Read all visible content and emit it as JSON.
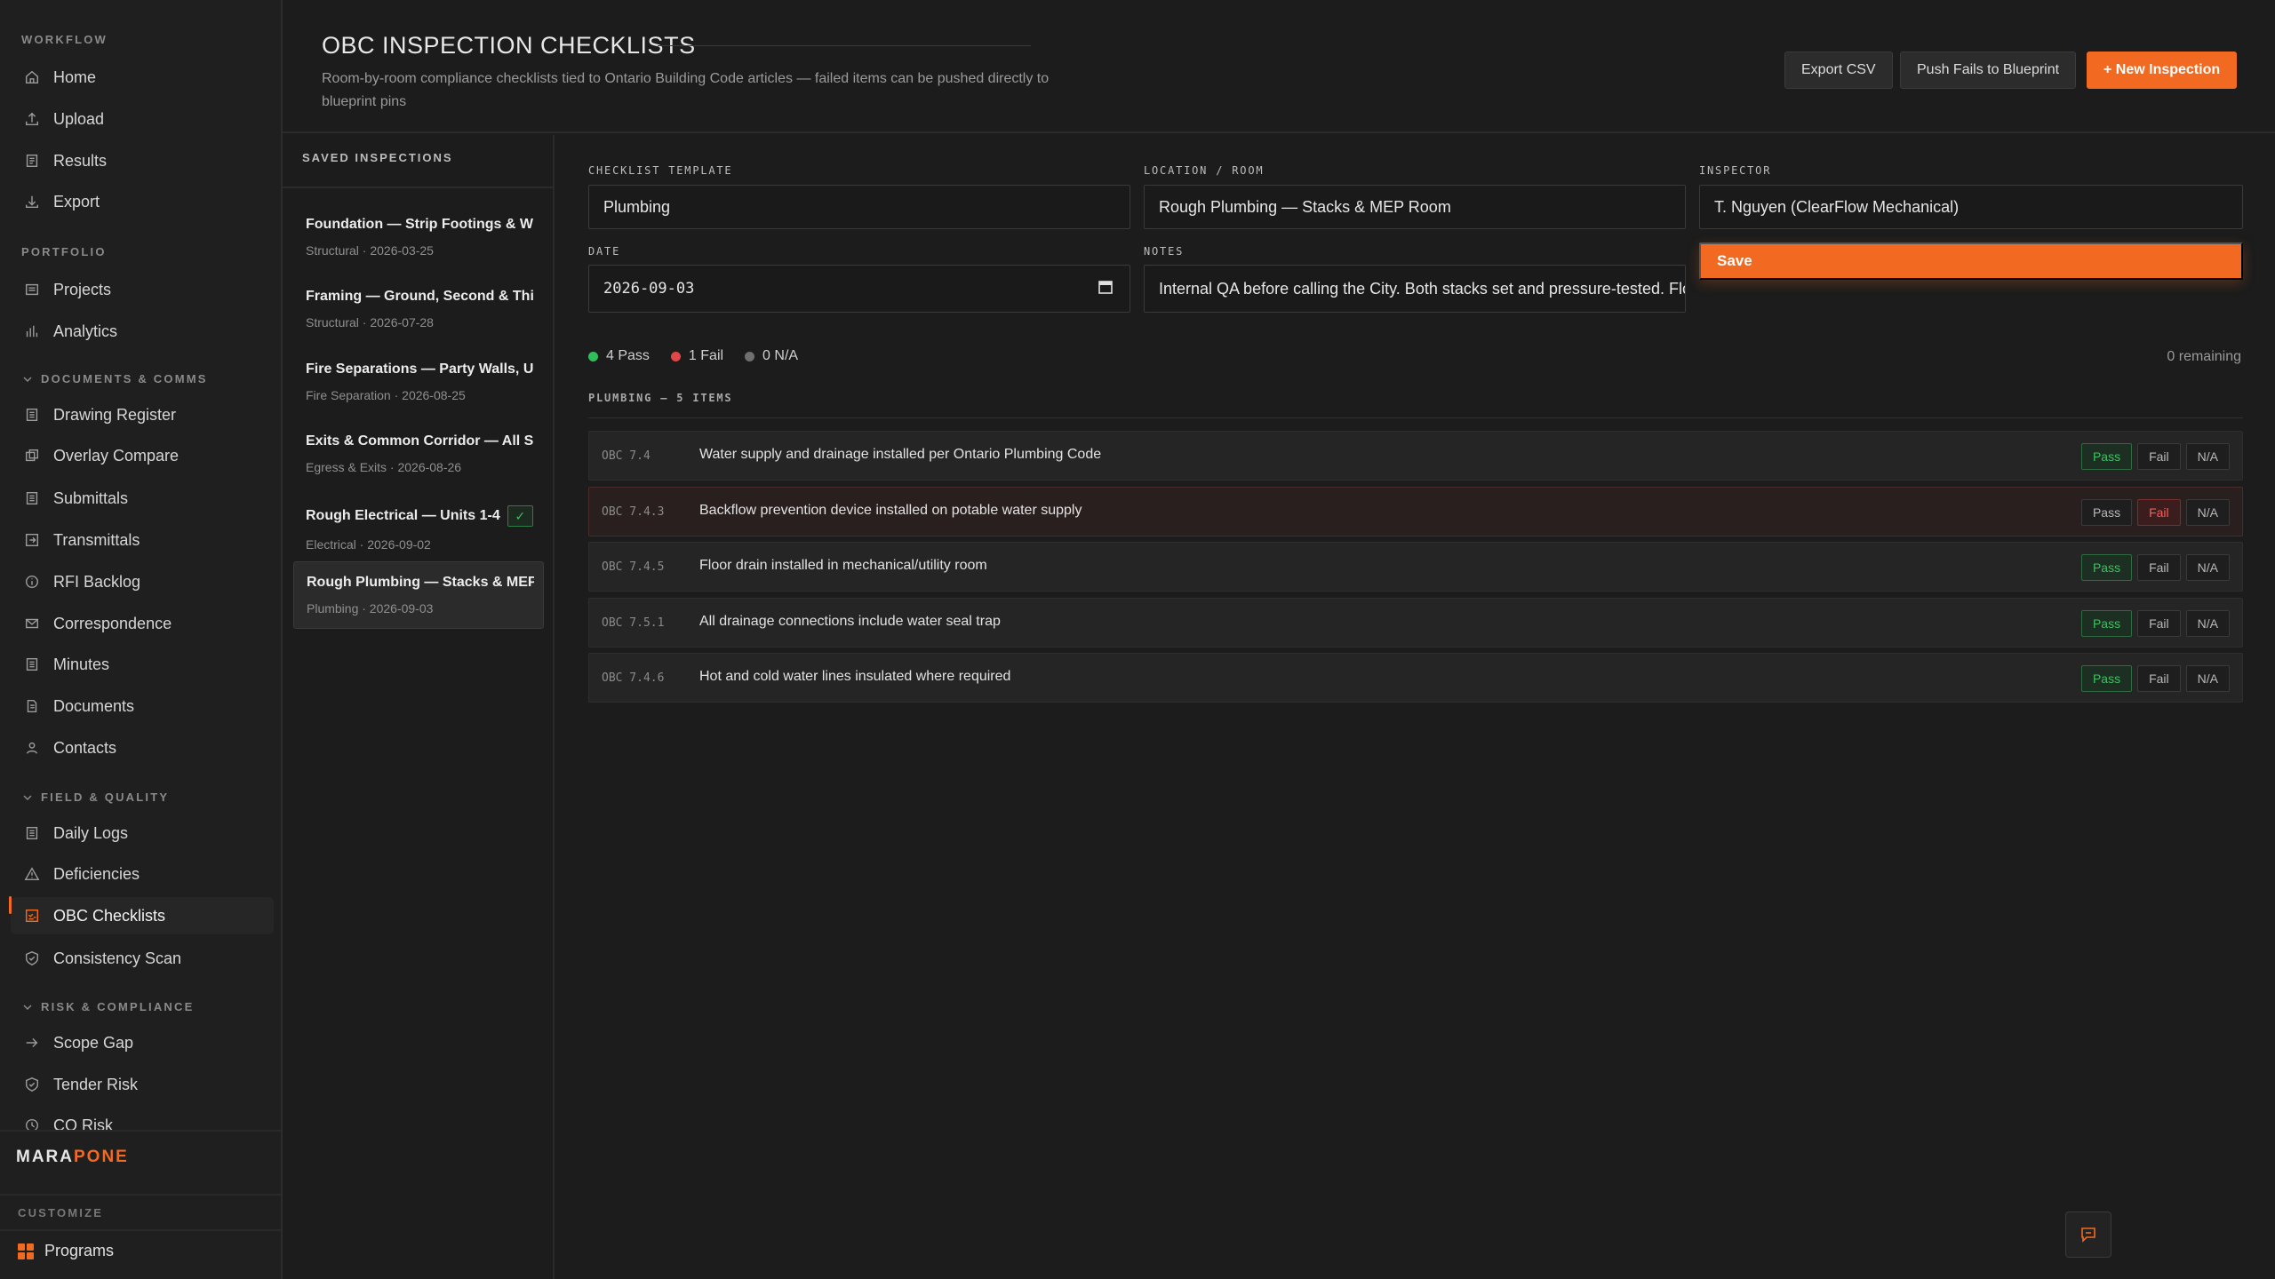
{
  "sidebar": {
    "sections": {
      "workflow": "WORKFLOW",
      "portfolio": "PORTFOLIO",
      "documents": "DOCUMENTS & COMMS",
      "field": "FIELD & QUALITY",
      "risk": "RISK & COMPLIANCE"
    },
    "workflow_items": [
      "Home",
      "Upload",
      "Results",
      "Export"
    ],
    "portfolio_items": [
      "Projects",
      "Analytics"
    ],
    "documents_items": [
      "Drawing Register",
      "Overlay Compare",
      "Submittals",
      "Transmittals",
      "RFI Backlog",
      "Correspondence",
      "Minutes",
      "Documents",
      "Contacts"
    ],
    "field_items": [
      "Daily Logs",
      "Deficiencies",
      "OBC Checklists",
      "Consistency Scan"
    ],
    "risk_items": [
      "Scope Gap",
      "Tender Risk",
      "CO Risk"
    ],
    "active_item": "OBC Checklists",
    "brand_main": "MARA",
    "brand_accent": "PONE",
    "customize_label": "CUSTOMIZE",
    "programs_label": "Programs"
  },
  "header": {
    "title": "OBC INSPECTION CHECKLISTS",
    "subtitle": "Room-by-room compliance checklists tied to Ontario Building Code articles — failed items can be pushed directly to blueprint pins",
    "export_csv": "Export CSV",
    "push_fails": "Push Fails to Blueprint",
    "new_inspection": "+ New Inspection"
  },
  "saved": {
    "heading": "SAVED INSPECTIONS",
    "items": [
      {
        "title": "Foundation — Strip Footings & W...",
        "meta": "Structural · 2026-03-25"
      },
      {
        "title": "Framing — Ground, Second & Thi...",
        "meta": "Structural · 2026-07-28"
      },
      {
        "title": "Fire Separations — Party Walls, U...",
        "meta": "Fire Separation · 2026-08-25"
      },
      {
        "title": "Exits & Common Corridor — All S...",
        "meta": "Egress & Exits · 2026-08-26"
      },
      {
        "title": "Rough Electrical — Units 1-4",
        "meta": "Electrical · 2026-09-02",
        "badge": "✓"
      },
      {
        "title": "Rough Plumbing — Stacks & MEP...",
        "meta": "Plumbing · 2026-09-03"
      }
    ]
  },
  "form": {
    "template_label": "CHECKLIST TEMPLATE",
    "template_value": "Plumbing",
    "location_label": "LOCATION / ROOM",
    "location_value": "Rough Plumbing — Stacks & MEP Room",
    "inspector_label": "INSPECTOR",
    "inspector_value": "T. Nguyen (ClearFlow Mechanical)",
    "date_label": "DATE",
    "date_value": "2026-09-03",
    "notes_label": "NOTES",
    "notes_value": "Internal QA before calling the City. Both stacks set and pressure-tested. Floor drain",
    "save_label": "Save"
  },
  "summary": {
    "pass": "4 Pass",
    "fail": "1 Fail",
    "na": "0 N/A",
    "remaining": "0 remaining",
    "colors": {
      "pass": "#2fbf5a",
      "fail": "#e04848",
      "na": "#6f6f6f"
    }
  },
  "checklist": {
    "group": "PLUMBING — 5 ITEMS",
    "option_labels": {
      "pass": "Pass",
      "fail": "Fail",
      "na": "N/A"
    },
    "items": [
      {
        "code": "OBC 7.4",
        "text": "Water supply and drainage installed per Ontario Plumbing Code",
        "status": "pass"
      },
      {
        "code": "OBC 7.4.3",
        "text": "Backflow prevention device installed on potable water supply",
        "status": "fail"
      },
      {
        "code": "OBC 7.4.5",
        "text": "Floor drain installed in mechanical/utility room",
        "status": "pass"
      },
      {
        "code": "OBC 7.5.1",
        "text": "All drainage connections include water seal trap",
        "status": "pass"
      },
      {
        "code": "OBC 7.4.6",
        "text": "Hot and cold water lines insulated where required",
        "status": "pass"
      }
    ]
  },
  "colors": {
    "accent": "#f26a21",
    "background": "#1c1c1c"
  }
}
